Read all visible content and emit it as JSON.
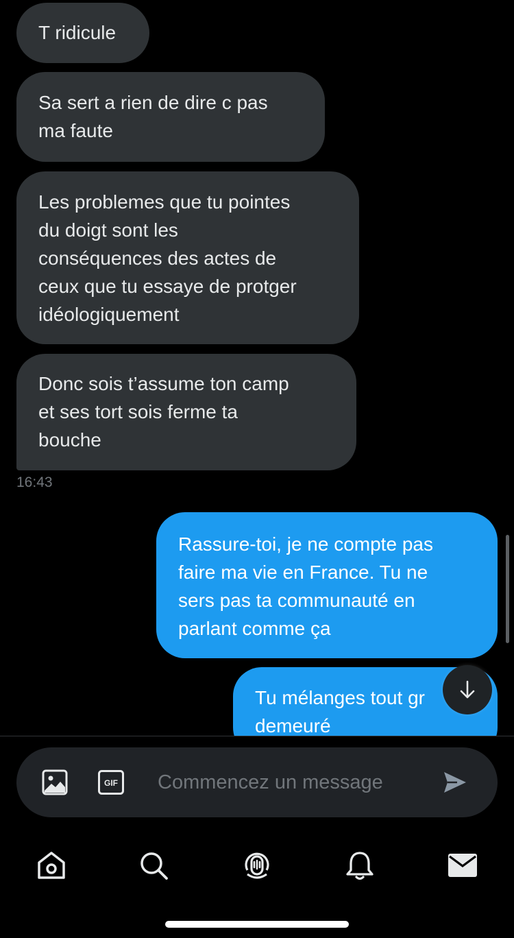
{
  "conversation": {
    "messages": [
      {
        "direction": "received",
        "text": "T ridicule"
      },
      {
        "direction": "received",
        "text": "Sa sert a rien de dire c pas\nma faute"
      },
      {
        "direction": "received",
        "text": "Les problemes que tu pointes\ndu doigt sont les\nconséquences des actes de\nceux que tu essaye de protger\nidéologiquement"
      },
      {
        "direction": "received",
        "text": "Donc sois t’assume ton camp\net ses tort sois ferme ta\nbouche"
      },
      {
        "direction": "sent",
        "text": "Rassure-toi, je ne compte pas\nfaire ma vie en France. Tu ne\nsers pas ta communauté en\nparlant comme ça"
      },
      {
        "direction": "sent",
        "text": "Tu mélanges tout gr\ndemeuré"
      }
    ],
    "timestamp": "16:43"
  },
  "composer": {
    "placeholder": "Commencez un message",
    "gif_label": "GIF"
  },
  "colors": {
    "background": "#000000",
    "received_bubble": "#2f3336",
    "sent_bubble": "#1d9bf0",
    "muted_text": "#71767b"
  },
  "icons": {
    "composer": [
      "image-icon",
      "gif-icon",
      "send-icon"
    ],
    "nav": [
      "home-icon",
      "search-icon",
      "spaces-icon",
      "notifications-icon",
      "messages-icon"
    ],
    "scroll": "arrow-down-icon"
  }
}
